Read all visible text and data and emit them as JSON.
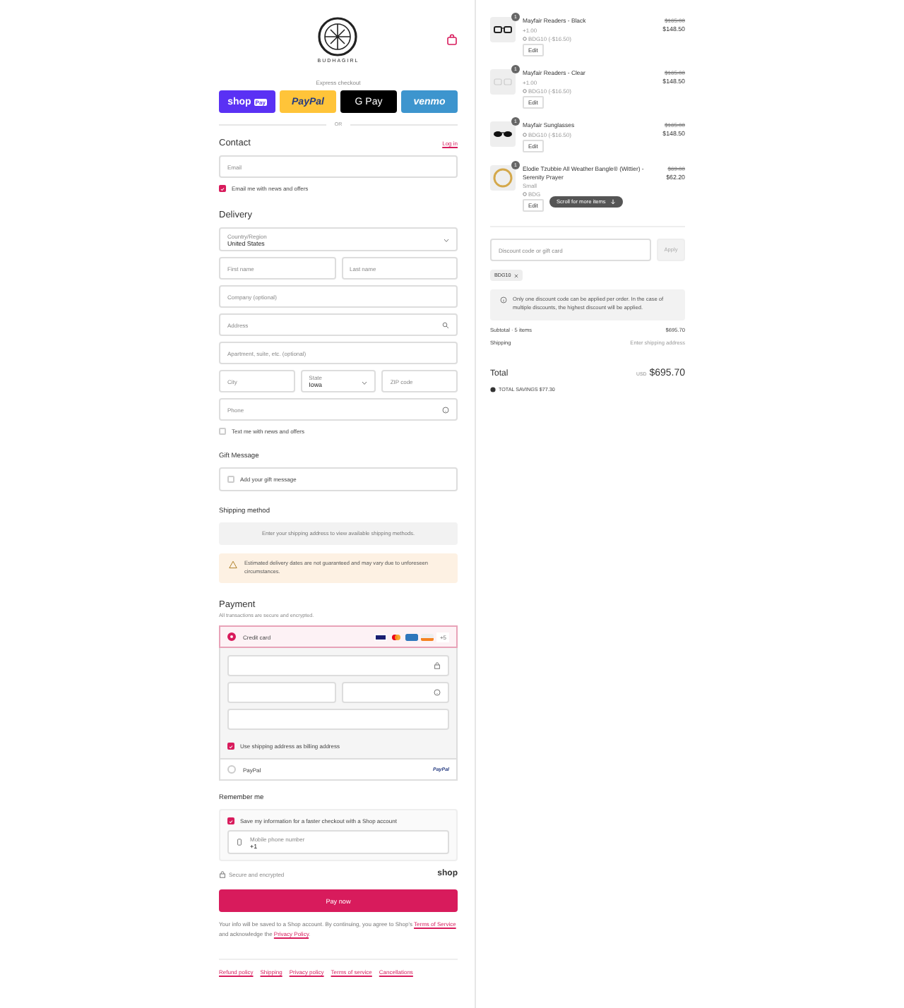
{
  "header": {
    "logo_text": "BUDHAGIRL",
    "express_label": "Express checkout",
    "or_label": "OR"
  },
  "pay_buttons": [
    {
      "kind": "shop",
      "label": "shop",
      "badge": "Pay"
    },
    {
      "kind": "paypal",
      "label": "PayPal"
    },
    {
      "kind": "gpay",
      "label": "G Pay"
    },
    {
      "kind": "venmo",
      "label": "venmo"
    }
  ],
  "contact": {
    "title": "Contact",
    "login_link": "Log in",
    "email_placeholder": "Email",
    "news": {
      "label": "Email me with news and offers",
      "checked": true
    }
  },
  "delivery": {
    "title": "Delivery",
    "country": {
      "label": "Country/Region",
      "value": "United States"
    },
    "first_name": "First name",
    "last_name": "Last name",
    "company": "Company (optional)",
    "address": "Address",
    "apartment": "Apartment, suite, etc. (optional)",
    "city": "City",
    "state": {
      "label": "State",
      "value": "Iowa"
    },
    "zip": "ZIP code",
    "phone": "Phone",
    "text_me": {
      "label": "Text me with news and offers",
      "checked": false
    }
  },
  "gift": {
    "title": "Gift Message",
    "field": {
      "label": "Add your gift message",
      "checked": false
    }
  },
  "shipping": {
    "title": "Shipping method",
    "notice": "Enter your shipping address to view available shipping methods.",
    "warning": "Estimated delivery dates are not guaranteed and may vary due to unforeseen circumstances."
  },
  "payment": {
    "title": "Payment",
    "subtitle": "All transactions are secure and encrypted.",
    "methods": [
      {
        "kind": "card",
        "label": "Credit card",
        "selected": true,
        "more": "+5"
      },
      {
        "kind": "paypal",
        "label": "PayPal",
        "selected": false,
        "logo": "PayPal"
      }
    ],
    "billing": {
      "label": "Use shipping address as billing address",
      "checked": true
    }
  },
  "remember": {
    "title": "Remember me",
    "save": {
      "label": "Save my information for a faster checkout with a Shop account",
      "checked": true
    },
    "mobile": {
      "label": "Mobile phone number",
      "value": "+1"
    }
  },
  "secure_note": "Secure and encrypted",
  "shop_logo": "shop",
  "pay_now": "Pay now",
  "legal": {
    "text": "Your info will be saved to a Shop account. By continuing, you agree to Shop’s ",
    "terms": "Terms of Service",
    "middle": " and acknowledge the ",
    "privacy": "Privacy Policy",
    "end": "."
  },
  "footer_links": [
    "Refund policy",
    "Shipping",
    "Privacy policy",
    "Terms of service",
    "Cancellations"
  ],
  "cart": {
    "items": [
      {
        "kind": "glasses",
        "quantity": "1",
        "name": "Mayfair Readers - Black",
        "variant": "+1.00",
        "discount": "BDG10 (-$16.50)",
        "edit": "Edit",
        "original_price": "$165.00",
        "price": "$148.50"
      },
      {
        "kind": "clear",
        "quantity": "1",
        "name": "Mayfair Readers - Clear",
        "variant": "+1.00",
        "discount": "BDG10 (-$16.50)",
        "edit": "Edit",
        "original_price": "$165.00",
        "price": "$148.50"
      },
      {
        "kind": "sunglasses",
        "quantity": "1",
        "name": "Mayfair Sunglasses",
        "discount": "BDG10 (-$16.50)",
        "edit": "Edit",
        "original_price": "$165.00",
        "price": "$148.50"
      },
      {
        "kind": "bangle",
        "quantity": "1",
        "name": "Elodie Tzubbie All Weather Bangle® (Wittier) - Serenity Prayer",
        "variant": "Small",
        "discount": "BDG",
        "edit": "Edit",
        "original_price": "$69.00",
        "price": "$62.20"
      }
    ],
    "scroll_hint": "Scroll for more items",
    "discount_placeholder": "Discount code or gift card",
    "apply": "Apply",
    "code": "BDG10",
    "info": "Only one discount code can be applied per order. In the case of multiple discounts, the highest discount will be applied.",
    "subtotal_label": "Subtotal · 5 items",
    "subtotal": "$695.70",
    "shipping_label": "Shipping",
    "shipping_value": "Enter shipping address",
    "total_label": "Total",
    "currency": "USD",
    "total": "$695.70",
    "savings": "TOTAL SAVINGS $77.30"
  }
}
